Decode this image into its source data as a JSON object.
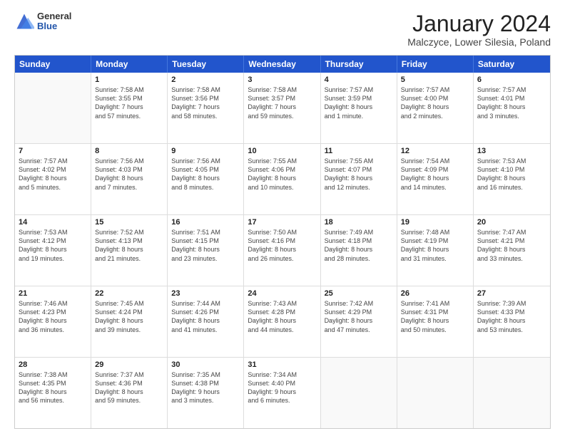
{
  "header": {
    "logo": {
      "general": "General",
      "blue": "Blue"
    },
    "title": "January 2024",
    "location": "Malczyce, Lower Silesia, Poland"
  },
  "calendar": {
    "days": [
      "Sunday",
      "Monday",
      "Tuesday",
      "Wednesday",
      "Thursday",
      "Friday",
      "Saturday"
    ],
    "weeks": [
      [
        {
          "day": null,
          "info": null
        },
        {
          "day": "1",
          "info": "Sunrise: 7:58 AM\nSunset: 3:55 PM\nDaylight: 7 hours\nand 57 minutes."
        },
        {
          "day": "2",
          "info": "Sunrise: 7:58 AM\nSunset: 3:56 PM\nDaylight: 7 hours\nand 58 minutes."
        },
        {
          "day": "3",
          "info": "Sunrise: 7:58 AM\nSunset: 3:57 PM\nDaylight: 7 hours\nand 59 minutes."
        },
        {
          "day": "4",
          "info": "Sunrise: 7:57 AM\nSunset: 3:59 PM\nDaylight: 8 hours\nand 1 minute."
        },
        {
          "day": "5",
          "info": "Sunrise: 7:57 AM\nSunset: 4:00 PM\nDaylight: 8 hours\nand 2 minutes."
        },
        {
          "day": "6",
          "info": "Sunrise: 7:57 AM\nSunset: 4:01 PM\nDaylight: 8 hours\nand 3 minutes."
        }
      ],
      [
        {
          "day": "7",
          "info": "Sunrise: 7:57 AM\nSunset: 4:02 PM\nDaylight: 8 hours\nand 5 minutes."
        },
        {
          "day": "8",
          "info": "Sunrise: 7:56 AM\nSunset: 4:03 PM\nDaylight: 8 hours\nand 7 minutes."
        },
        {
          "day": "9",
          "info": "Sunrise: 7:56 AM\nSunset: 4:05 PM\nDaylight: 8 hours\nand 8 minutes."
        },
        {
          "day": "10",
          "info": "Sunrise: 7:55 AM\nSunset: 4:06 PM\nDaylight: 8 hours\nand 10 minutes."
        },
        {
          "day": "11",
          "info": "Sunrise: 7:55 AM\nSunset: 4:07 PM\nDaylight: 8 hours\nand 12 minutes."
        },
        {
          "day": "12",
          "info": "Sunrise: 7:54 AM\nSunset: 4:09 PM\nDaylight: 8 hours\nand 14 minutes."
        },
        {
          "day": "13",
          "info": "Sunrise: 7:53 AM\nSunset: 4:10 PM\nDaylight: 8 hours\nand 16 minutes."
        }
      ],
      [
        {
          "day": "14",
          "info": "Sunrise: 7:53 AM\nSunset: 4:12 PM\nDaylight: 8 hours\nand 19 minutes."
        },
        {
          "day": "15",
          "info": "Sunrise: 7:52 AM\nSunset: 4:13 PM\nDaylight: 8 hours\nand 21 minutes."
        },
        {
          "day": "16",
          "info": "Sunrise: 7:51 AM\nSunset: 4:15 PM\nDaylight: 8 hours\nand 23 minutes."
        },
        {
          "day": "17",
          "info": "Sunrise: 7:50 AM\nSunset: 4:16 PM\nDaylight: 8 hours\nand 26 minutes."
        },
        {
          "day": "18",
          "info": "Sunrise: 7:49 AM\nSunset: 4:18 PM\nDaylight: 8 hours\nand 28 minutes."
        },
        {
          "day": "19",
          "info": "Sunrise: 7:48 AM\nSunset: 4:19 PM\nDaylight: 8 hours\nand 31 minutes."
        },
        {
          "day": "20",
          "info": "Sunrise: 7:47 AM\nSunset: 4:21 PM\nDaylight: 8 hours\nand 33 minutes."
        }
      ],
      [
        {
          "day": "21",
          "info": "Sunrise: 7:46 AM\nSunset: 4:23 PM\nDaylight: 8 hours\nand 36 minutes."
        },
        {
          "day": "22",
          "info": "Sunrise: 7:45 AM\nSunset: 4:24 PM\nDaylight: 8 hours\nand 39 minutes."
        },
        {
          "day": "23",
          "info": "Sunrise: 7:44 AM\nSunset: 4:26 PM\nDaylight: 8 hours\nand 41 minutes."
        },
        {
          "day": "24",
          "info": "Sunrise: 7:43 AM\nSunset: 4:28 PM\nDaylight: 8 hours\nand 44 minutes."
        },
        {
          "day": "25",
          "info": "Sunrise: 7:42 AM\nSunset: 4:29 PM\nDaylight: 8 hours\nand 47 minutes."
        },
        {
          "day": "26",
          "info": "Sunrise: 7:41 AM\nSunset: 4:31 PM\nDaylight: 8 hours\nand 50 minutes."
        },
        {
          "day": "27",
          "info": "Sunrise: 7:39 AM\nSunset: 4:33 PM\nDaylight: 8 hours\nand 53 minutes."
        }
      ],
      [
        {
          "day": "28",
          "info": "Sunrise: 7:38 AM\nSunset: 4:35 PM\nDaylight: 8 hours\nand 56 minutes."
        },
        {
          "day": "29",
          "info": "Sunrise: 7:37 AM\nSunset: 4:36 PM\nDaylight: 8 hours\nand 59 minutes."
        },
        {
          "day": "30",
          "info": "Sunrise: 7:35 AM\nSunset: 4:38 PM\nDaylight: 9 hours\nand 3 minutes."
        },
        {
          "day": "31",
          "info": "Sunrise: 7:34 AM\nSunset: 4:40 PM\nDaylight: 9 hours\nand 6 minutes."
        },
        {
          "day": null,
          "info": null
        },
        {
          "day": null,
          "info": null
        },
        {
          "day": null,
          "info": null
        }
      ]
    ]
  }
}
